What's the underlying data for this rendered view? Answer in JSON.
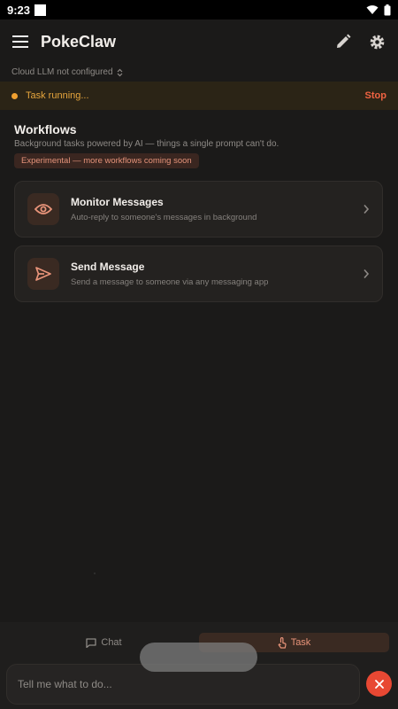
{
  "status_bar": {
    "time": "9:23"
  },
  "app_bar": {
    "title": "PokeClaw"
  },
  "llm_selector": {
    "label": "Cloud LLM not configured"
  },
  "task_banner": {
    "text": "Task running...",
    "stop_label": "Stop"
  },
  "workflows": {
    "title": "Workflows",
    "subtitle": "Background tasks powered by AI — things a single prompt can't do.",
    "badge": "Experimental — more workflows coming soon",
    "items": [
      {
        "title": "Monitor Messages",
        "subtitle": "Auto-reply to someone's messages in background",
        "icon": "eye-icon"
      },
      {
        "title": "Send Message",
        "subtitle": "Send a message to someone via any messaging app",
        "icon": "send-icon"
      }
    ]
  },
  "tabs": [
    {
      "label": "Chat",
      "icon": "chat-icon"
    },
    {
      "label": "Task",
      "icon": "touch-icon"
    }
  ],
  "input": {
    "placeholder": "Tell me what to do..."
  },
  "colors": {
    "accent": "#e9947a",
    "warning": "#e7a63d",
    "danger": "#e84833",
    "background": "#1b1a19"
  }
}
